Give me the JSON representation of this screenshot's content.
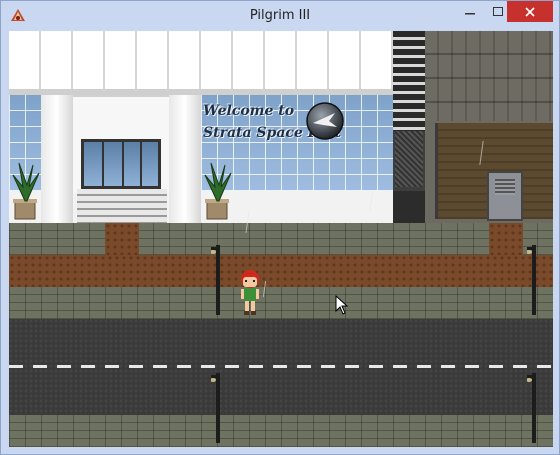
{
  "window": {
    "title": "Pilgrim III",
    "controls": {
      "minimize": "minimize",
      "maximize": "maximize",
      "close": "close"
    }
  },
  "scene": {
    "sign": {
      "line1": "Welcome to",
      "line2": "Strata Space Port"
    },
    "weather": "rain",
    "player": "red-haired-girl"
  },
  "colors": {
    "close_button": "#c7312d",
    "titlebar": "#c9d8f0",
    "road": "#3a3a3a",
    "dirt": "#7a4a2a",
    "sign_text": "#1e2f44"
  }
}
